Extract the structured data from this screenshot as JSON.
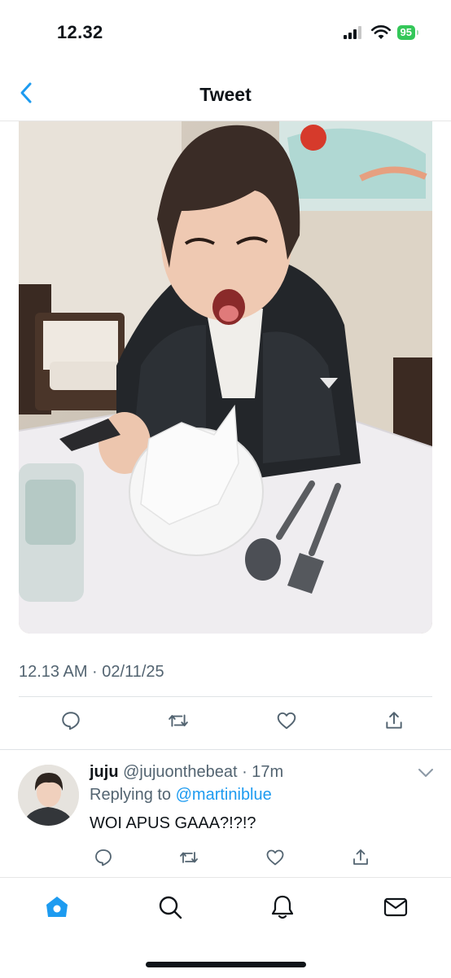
{
  "status_bar": {
    "time": "12.32",
    "battery": "95"
  },
  "nav": {
    "title": "Tweet",
    "back_icon": "chevron-left-icon"
  },
  "tweet": {
    "image_alt": "Photo of a young man in a dark puffer jacket sitting at a restaurant table, making an open-mouthed face, with a white plate, napkin, spoon, fork and glass on the table",
    "timestamp": "12.13 AM · 02/11/25",
    "actions": [
      "reply-icon",
      "retweet-icon",
      "like-icon",
      "share-icon"
    ]
  },
  "reply": {
    "name": "juju",
    "handle": "@jujuonthebeat",
    "time": "· 17m",
    "replying_prefix": "Replying to ",
    "replying_to": "@martiniblue",
    "text": "WOI APUS GAAA?!?!?"
  },
  "tabbar": {
    "tabs": [
      "home-icon",
      "search-icon",
      "notifications-icon",
      "messages-icon"
    ]
  },
  "colors": {
    "accent": "#1d9bf0",
    "secondary_text": "#536471",
    "battery": "#34c759"
  }
}
